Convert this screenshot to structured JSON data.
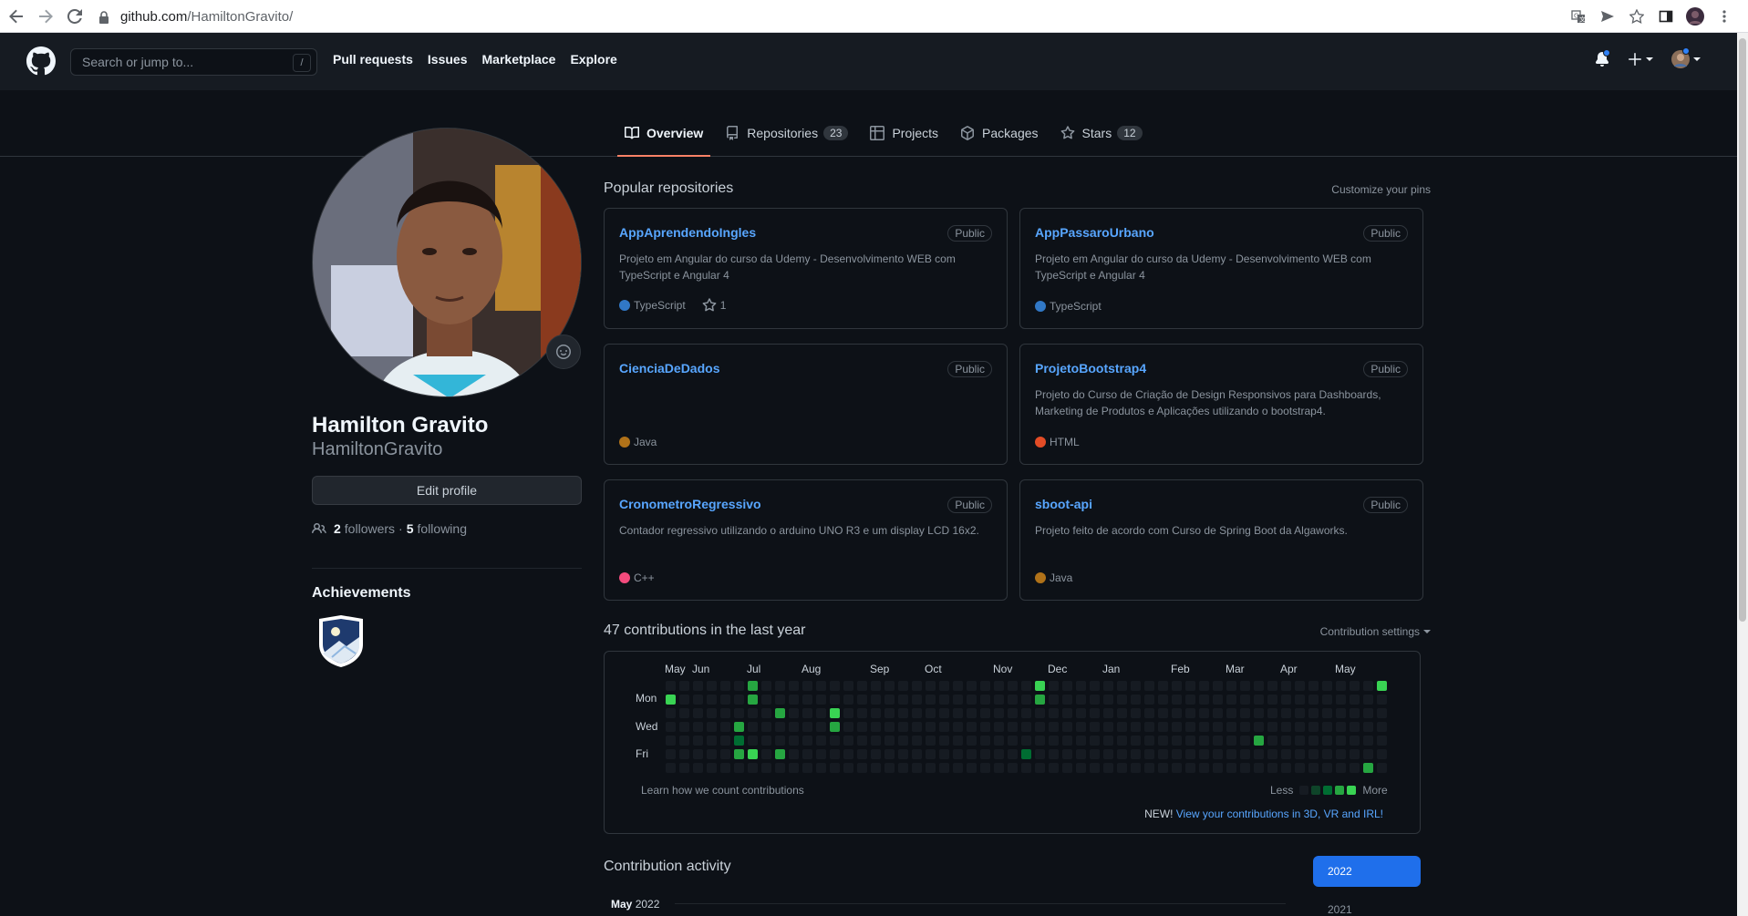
{
  "browser": {
    "url_host": "github.com",
    "url_path": "/HamiltonGravito/"
  },
  "header": {
    "search_placeholder": "Search or jump to...",
    "search_key": "/",
    "nav": [
      "Pull requests",
      "Issues",
      "Marketplace",
      "Explore"
    ]
  },
  "tabs": [
    {
      "label": "Overview",
      "count": null,
      "icon": "book-icon",
      "active": true
    },
    {
      "label": "Repositories",
      "count": "23",
      "icon": "repo-icon",
      "active": false
    },
    {
      "label": "Projects",
      "count": null,
      "icon": "table-icon",
      "active": false
    },
    {
      "label": "Packages",
      "count": null,
      "icon": "package-icon",
      "active": false
    },
    {
      "label": "Stars",
      "count": "12",
      "icon": "star-icon",
      "active": false
    }
  ],
  "profile": {
    "name": "Hamilton Gravito",
    "login": "HamiltonGravito",
    "edit_label": "Edit profile",
    "followers_count": "2",
    "followers_label": "followers",
    "separator": "·",
    "following_count": "5",
    "following_label": "following",
    "achievements_title": "Achievements"
  },
  "popular": {
    "title": "Popular repositories",
    "customize": "Customize your pins",
    "repos": [
      {
        "name": "AppAprendendoIngles",
        "visibility": "Public",
        "description": "Projeto em Angular do curso da Udemy - Desenvolvimento WEB com TypeScript e Angular 4",
        "language": "TypeScript",
        "lang_color": "#3178c6",
        "stars": "1"
      },
      {
        "name": "AppPassaroUrbano",
        "visibility": "Public",
        "description": "Projeto em Angular do curso da Udemy - Desenvolvimento WEB com TypeScript e Angular 4",
        "language": "TypeScript",
        "lang_color": "#3178c6",
        "stars": null
      },
      {
        "name": "CienciaDeDados",
        "visibility": "Public",
        "description": "",
        "language": "Java",
        "lang_color": "#b07219",
        "stars": null
      },
      {
        "name": "ProjetoBootstrap4",
        "visibility": "Public",
        "description": "Projeto do Curso de Criação de Design Responsivos para Dashboards, Marketing de Produtos e Aplicações utilizando o bootstrap4.",
        "language": "HTML",
        "lang_color": "#e34c26",
        "stars": null
      },
      {
        "name": "CronometroRegressivo",
        "visibility": "Public",
        "description": "Contador regressivo utilizando o arduino UNO R3 e um display LCD 16x2.",
        "language": "C++",
        "lang_color": "#f34b7d",
        "stars": null
      },
      {
        "name": "sboot-api",
        "visibility": "Public",
        "description": "Projeto feito de acordo com Curso de Spring Boot da Algaworks.",
        "language": "Java",
        "lang_color": "#b07219",
        "stars": null
      }
    ]
  },
  "contributions": {
    "title": "47 contributions in the last year",
    "settings": "Contribution settings",
    "months": [
      "May",
      "Jun",
      "Jul",
      "Aug",
      "Sep",
      "Oct",
      "Nov",
      "Dec",
      "Jan",
      "Feb",
      "Mar",
      "Apr",
      "May"
    ],
    "days": [
      "Mon",
      "Wed",
      "Fri"
    ],
    "learn": "Learn how we count contributions",
    "less": "Less",
    "more": "More",
    "new_prefix": "NEW!",
    "new_link": "View your contributions in 3D, VR and IRL!",
    "colors": [
      "#161b22",
      "#0e4429",
      "#006d32",
      "#26a641",
      "#39d353"
    ],
    "active_cells": [
      {
        "week": 0,
        "day": 1,
        "level": 4
      },
      {
        "week": 5,
        "day": 3,
        "level": 3
      },
      {
        "week": 5,
        "day": 4,
        "level": 2
      },
      {
        "week": 5,
        "day": 5,
        "level": 3
      },
      {
        "week": 6,
        "day": 0,
        "level": 3
      },
      {
        "week": 6,
        "day": 1,
        "level": 3
      },
      {
        "week": 6,
        "day": 5,
        "level": 4
      },
      {
        "week": 8,
        "day": 2,
        "level": 3
      },
      {
        "week": 8,
        "day": 5,
        "level": 3
      },
      {
        "week": 12,
        "day": 2,
        "level": 4
      },
      {
        "week": 12,
        "day": 3,
        "level": 3
      },
      {
        "week": 26,
        "day": 5,
        "level": 2
      },
      {
        "week": 27,
        "day": 0,
        "level": 4
      },
      {
        "week": 27,
        "day": 1,
        "level": 3
      },
      {
        "week": 43,
        "day": 4,
        "level": 3
      },
      {
        "week": 51,
        "day": 6,
        "level": 3
      },
      {
        "week": 52,
        "day": 0,
        "level": 4
      }
    ]
  },
  "activity": {
    "title": "Contribution activity",
    "month": "May",
    "year_inline": "2022",
    "years": [
      "2022",
      "2021"
    ]
  }
}
